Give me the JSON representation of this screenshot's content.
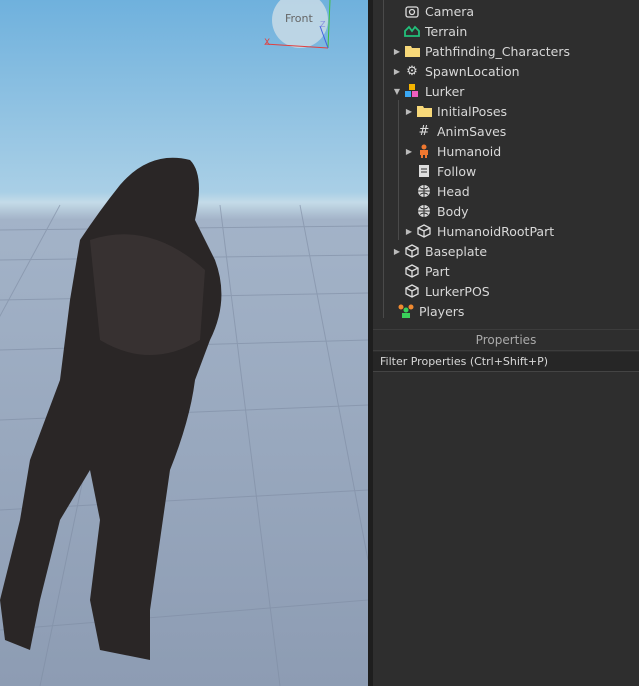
{
  "viewport": {
    "view_cube_label": "Front",
    "axis_x": "X",
    "axis_z": "Z"
  },
  "explorer": {
    "items": [
      {
        "label": "Camera",
        "icon": "camera-icon",
        "expandable": false,
        "depth": 0
      },
      {
        "label": "Terrain",
        "icon": "terrain-icon",
        "expandable": false,
        "depth": 0
      },
      {
        "label": "Pathfinding_Characters",
        "icon": "folder-icon",
        "expandable": true,
        "depth": 0
      },
      {
        "label": "SpawnLocation",
        "icon": "spawn-location-icon",
        "expandable": true,
        "depth": 0
      },
      {
        "label": "Lurker",
        "icon": "model-icon",
        "expandable": true,
        "expanded": true,
        "depth": 0
      },
      {
        "label": "InitialPoses",
        "icon": "folder-icon",
        "expandable": true,
        "depth": 1
      },
      {
        "label": "AnimSaves",
        "icon": "hash-icon",
        "expandable": false,
        "depth": 1
      },
      {
        "label": "Humanoid",
        "icon": "humanoid-icon",
        "expandable": true,
        "depth": 1
      },
      {
        "label": "Follow",
        "icon": "script-icon",
        "expandable": false,
        "depth": 1
      },
      {
        "label": "Head",
        "icon": "mesh-icon",
        "expandable": false,
        "depth": 1
      },
      {
        "label": "Body",
        "icon": "mesh-icon",
        "expandable": false,
        "depth": 1
      },
      {
        "label": "HumanoidRootPart",
        "icon": "part-icon",
        "expandable": true,
        "depth": 1
      },
      {
        "label": "Baseplate",
        "icon": "part-icon",
        "expandable": true,
        "depth": 0
      },
      {
        "label": "Part",
        "icon": "part-icon",
        "expandable": false,
        "depth": 0
      },
      {
        "label": "LurkerPOS",
        "icon": "part-icon",
        "expandable": false,
        "depth": 0
      },
      {
        "label": "Players",
        "icon": "players-icon",
        "expandable": false,
        "depth": -1
      }
    ]
  },
  "properties": {
    "title": "Properties",
    "filter_placeholder": "Filter Properties (Ctrl+Shift+P)"
  }
}
